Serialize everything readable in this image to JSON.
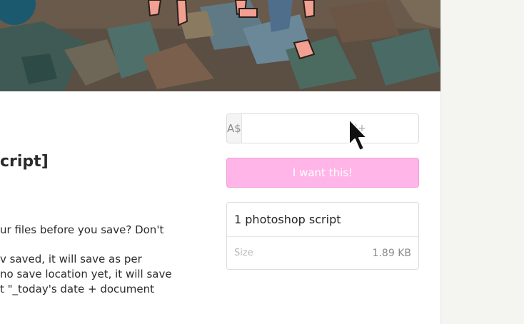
{
  "product": {
    "title_fragment": "cript]",
    "description_lines": [
      "ur files before you save? Don't",
      "",
      "v saved, it will save as per",
      " no save location yet, it will save",
      "t \"_today's date + document"
    ]
  },
  "purchase": {
    "currency": "A$",
    "price_placeholder": "0+",
    "buy_label": "I want this!"
  },
  "details": {
    "title": "1 photoshop script",
    "size_label": "Size",
    "size_value": "1.89 KB"
  },
  "colors": {
    "accent_pink": "#ffb5e8",
    "page_bg": "#f4f4f0"
  },
  "icons": {
    "pointer": "mouse-pointer-icon"
  }
}
